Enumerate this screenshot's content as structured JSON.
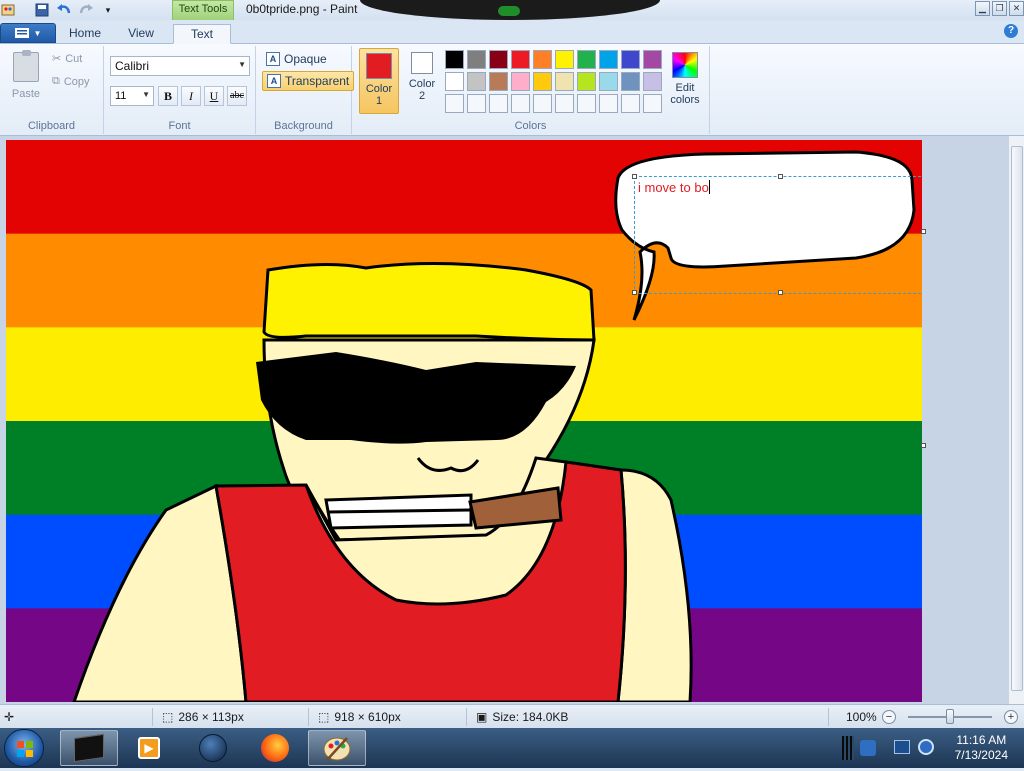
{
  "window": {
    "title": "0b0tpride.png - Paint",
    "context_tab": "Text Tools"
  },
  "quick_access": {
    "icons": [
      "paint-app-icon",
      "save-icon",
      "undo-icon",
      "redo-icon",
      "customize-dropdown-icon"
    ]
  },
  "tabs": [
    {
      "label": "Home",
      "active": false
    },
    {
      "label": "View",
      "active": false
    },
    {
      "label": "Text",
      "active": true
    }
  ],
  "ribbon": {
    "clipboard": {
      "group_label": "Clipboard",
      "paste_label": "Paste",
      "cut_label": "Cut",
      "copy_label": "Copy"
    },
    "font": {
      "group_label": "Font",
      "family": "Calibri",
      "size": "11",
      "bold": "B",
      "italic": "I",
      "underline": "U",
      "strike": "abc"
    },
    "background": {
      "group_label": "Background",
      "opaque_label": "Opaque",
      "transparent_label": "Transparent",
      "selected": "Transparent"
    },
    "colors": {
      "group_label": "Colors",
      "color1_label": "Color\n1",
      "color1_l1": "Color",
      "color1_l2": "1",
      "color2_l1": "Color",
      "color2_l2": "2",
      "color1": "#e21c23",
      "color2": "#ffffff",
      "edit_l1": "Edit",
      "edit_l2": "colors",
      "palette": [
        "#000000",
        "#7f7f7f",
        "#880015",
        "#ed1c24",
        "#ff7f27",
        "#fff200",
        "#22b14c",
        "#00a2e8",
        "#3f48cc",
        "#a349a4",
        "#ffffff",
        "#c3c3c3",
        "#b97a57",
        "#ffaec9",
        "#ffc90e",
        "#efe4b0",
        "#b5e61d",
        "#99d9ea",
        "#7092be",
        "#c8bfe7",
        "",
        "",
        "",
        "",
        "",
        "",
        "",
        "",
        "",
        ""
      ]
    }
  },
  "canvas": {
    "typed_text": "i move to bo",
    "flag_colors": [
      "#e40303",
      "#ff8c00",
      "#ffed00",
      "#008026",
      "#004dff",
      "#750787"
    ]
  },
  "status": {
    "selection_size": "286 × 113px",
    "image_size": "918 × 610px",
    "file_size": "Size: 184.0KB",
    "zoom": "100%"
  },
  "taskbar": {
    "time": "11:16 AM",
    "date": "7/13/2024",
    "apps": [
      "terminal-icon",
      "media-player-icon",
      "browser-globe-icon",
      "firefox-icon",
      "paint-icon"
    ]
  }
}
